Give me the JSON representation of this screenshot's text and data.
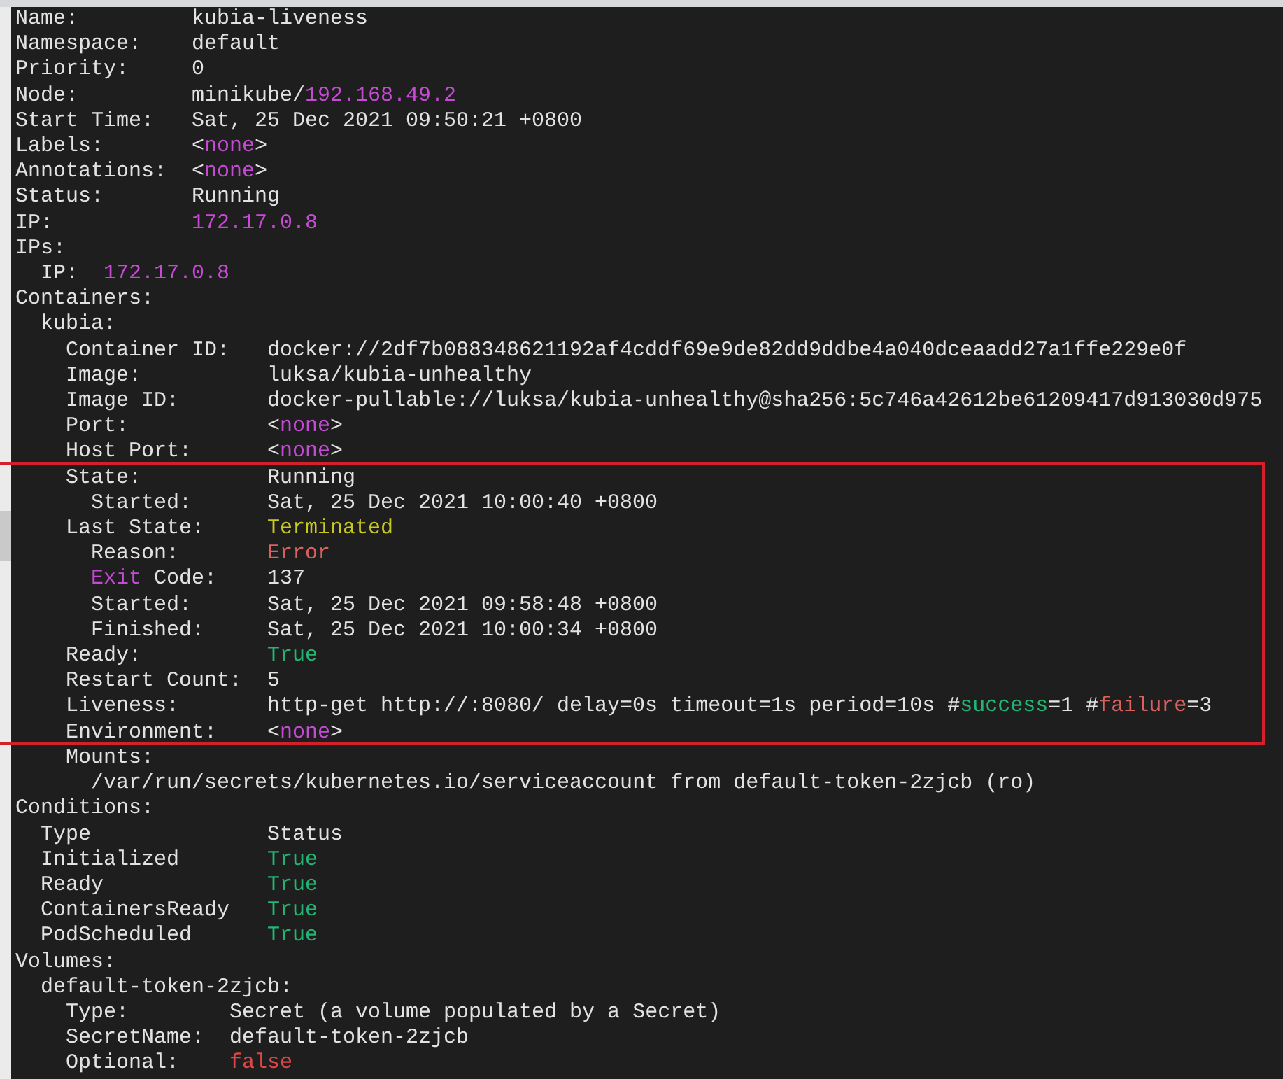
{
  "terminal": {
    "lines": [
      {
        "key": "Name:",
        "value": [
          {
            "text": "kubia-liveness"
          }
        ]
      },
      {
        "key": "Namespace:",
        "value": [
          {
            "text": "default"
          }
        ]
      },
      {
        "key": "Priority:",
        "value": [
          {
            "text": "0"
          }
        ]
      },
      {
        "key": "Node:",
        "value": [
          {
            "text": "minikube/"
          },
          {
            "text": "192.168.49.2",
            "color": "#c74ad6"
          }
        ]
      },
      {
        "key": "Start Time:",
        "value": [
          {
            "text": "Sat, 25 Dec 2021 09:50:21 +0800"
          }
        ]
      },
      {
        "key": "Labels:",
        "value": [
          {
            "text": "<"
          },
          {
            "text": "none",
            "color": "#c74ad6"
          },
          {
            "text": ">"
          }
        ]
      },
      {
        "key": "Annotations:",
        "value": [
          {
            "text": "<"
          },
          {
            "text": "none",
            "color": "#c74ad6"
          },
          {
            "text": ">"
          }
        ]
      },
      {
        "key": "Status:",
        "value": [
          {
            "text": "Running"
          }
        ]
      },
      {
        "key": "IP:",
        "value": [
          {
            "text": "172.17.0.8",
            "color": "#c74ad6"
          }
        ]
      },
      {
        "key": "IPs:",
        "children": [
          {
            "key": "IP:",
            "value": [
              {
                "text": "172.17.0.8",
                "color": "#c74ad6"
              }
            ]
          }
        ]
      },
      {
        "key": "Containers:",
        "children": [
          {
            "key": "kubia:",
            "children": [
              {
                "key": "Container ID:",
                "value": [
                  {
                    "text": "docker://2df7b088348621192af4cddf69e9de82dd9ddbe4a040dceaadd27a1ffe229e0f"
                  }
                ]
              },
              {
                "key": "Image:",
                "value": [
                  {
                    "text": "luksa/kubia-unhealthy"
                  }
                ]
              },
              {
                "key": "Image ID:",
                "value": [
                  {
                    "text": "docker-pullable://luksa/kubia-unhealthy@sha256:5c746a42612be61209417d913030d975"
                  }
                ]
              },
              {
                "key": "Port:",
                "value": [
                  {
                    "text": "<"
                  },
                  {
                    "text": "none",
                    "color": "#c74ad6"
                  },
                  {
                    "text": ">"
                  }
                ]
              },
              {
                "key": "Host Port:",
                "value": [
                  {
                    "text": "<"
                  },
                  {
                    "text": "none",
                    "color": "#c74ad6"
                  },
                  {
                    "text": ">"
                  }
                ]
              },
              {
                "kind": "highlight",
                "children": [
                  {
                    "key": "State:",
                    "value": [
                      {
                        "text": "Running"
                      }
                    ],
                    "children": [
                      {
                        "key": "Started:",
                        "value": [
                          {
                            "text": "Sat, 25 Dec 2021 10:00:40 +0800"
                          }
                        ]
                      }
                    ]
                  },
                  {
                    "key": "Last State:",
                    "value": [
                      {
                        "text": "Terminated",
                        "color": "#c8c81e"
                      }
                    ],
                    "children": [
                      {
                        "key": "Reason:",
                        "value": [
                          {
                            "text": "Error",
                            "color": "#d9625e"
                          }
                        ]
                      },
                      {
                        "key": [
                          {
                            "text": "Exit",
                            "color": "#c74ad6"
                          },
                          {
                            "text": " Code:"
                          }
                        ],
                        "value": [
                          {
                            "text": "137"
                          }
                        ]
                      },
                      {
                        "key": "Started:",
                        "value": [
                          {
                            "text": "Sat, 25 Dec 2021 09:58:48 +0800"
                          }
                        ]
                      },
                      {
                        "key": "Finished:",
                        "value": [
                          {
                            "text": "Sat, 25 Dec 2021 10:00:34 +0800"
                          }
                        ]
                      }
                    ]
                  },
                  {
                    "key": "Ready:",
                    "value": [
                      {
                        "text": "True",
                        "color": "#22b573"
                      }
                    ]
                  },
                  {
                    "key": "Restart Count:",
                    "value": [
                      {
                        "text": "5"
                      }
                    ]
                  },
                  {
                    "key": "Liveness:",
                    "value": [
                      {
                        "text": "http-get http://:8080/ delay=0s timeout=1s period=10s #"
                      },
                      {
                        "text": "success",
                        "color": "#22b573"
                      },
                      {
                        "text": "=1 #"
                      },
                      {
                        "text": "failure",
                        "color": "#d9625e"
                      },
                      {
                        "text": "=3"
                      }
                    ]
                  },
                  {
                    "key": "Environment:",
                    "value": [
                      {
                        "text": "<"
                      },
                      {
                        "text": "none",
                        "color": "#c74ad6"
                      },
                      {
                        "text": ">"
                      }
                    ]
                  }
                ]
              },
              {
                "key": "Mounts:",
                "children": [
                  {
                    "text": "/var/run/secrets/kubernetes.io/serviceaccount from default-token-2zjcb (ro)"
                  }
                ]
              }
            ]
          }
        ]
      },
      {
        "key": "Conditions:",
        "table": {
          "columns": [
            "Type",
            "Status"
          ],
          "rows": [
            {
              "type": "Initialized",
              "status": {
                "text": "True",
                "color": "#22b573"
              }
            },
            {
              "type": "Ready",
              "status": {
                "text": "True",
                "color": "#22b573"
              }
            },
            {
              "type": "ContainersReady",
              "status": {
                "text": "True",
                "color": "#22b573"
              }
            },
            {
              "type": "PodScheduled",
              "status": {
                "text": "True",
                "color": "#22b573"
              }
            }
          ]
        }
      },
      {
        "key": "Volumes:",
        "children": [
          {
            "key": "default-token-2zjcb:",
            "children": [
              {
                "key": "Type:",
                "value": [
                  {
                    "text": "Secret (a volume populated by a Secret)"
                  }
                ]
              },
              {
                "key": "SecretName:",
                "value": [
                  {
                    "text": "default-token-2zjcb"
                  }
                ]
              },
              {
                "key": "Optional:",
                "value": [
                  {
                    "text": "false",
                    "color": "#e04848"
                  }
                ]
              }
            ]
          }
        ]
      }
    ]
  }
}
